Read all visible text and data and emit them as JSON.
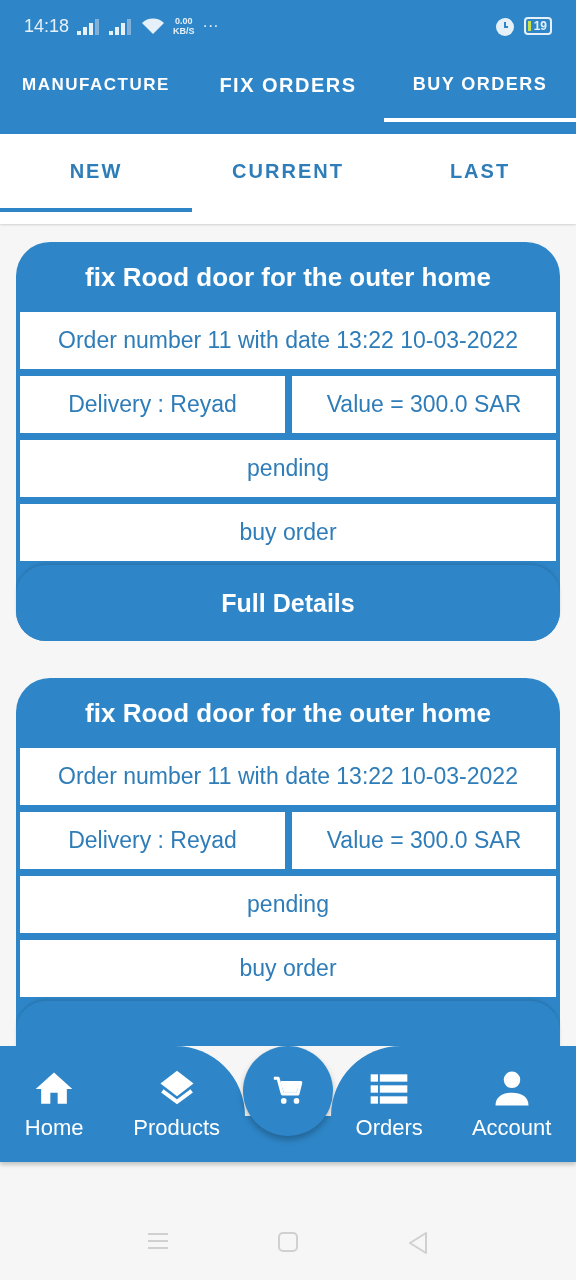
{
  "status_bar": {
    "time": "14:18",
    "net_speed": "0.00",
    "net_unit": "KB/S",
    "more": "···",
    "battery": "19"
  },
  "top_tabs": [
    {
      "label": "MANUFACTURE",
      "selected": false
    },
    {
      "label": "FIX ORDERS",
      "selected": false
    },
    {
      "label": "BUY ORDERS",
      "selected": true
    }
  ],
  "sub_tabs": [
    {
      "label": "NEW",
      "selected": true
    },
    {
      "label": "CURRENT",
      "selected": false
    },
    {
      "label": "LAST",
      "selected": false
    }
  ],
  "orders": [
    {
      "title": "fix Rood door for the outer home",
      "order_line": "Order number 11 with date 13:22 10-03-2022",
      "delivery": "Delivery : Reyad",
      "value": "Value = 300.0 SAR",
      "status": "pending",
      "type": "buy order",
      "button": "Full Details"
    },
    {
      "title": "fix Rood door for the outer home",
      "order_line": "Order number 11 with date 13:22 10-03-2022",
      "delivery": "Delivery : Reyad",
      "value": "Value = 300.0 SAR",
      "status": "pending",
      "type": "buy order"
    }
  ],
  "bottom_nav": [
    {
      "kind": "home",
      "label": "Home"
    },
    {
      "kind": "layers",
      "label": "Products"
    },
    {
      "kind": "cart"
    },
    {
      "kind": "list",
      "label": "Orders"
    },
    {
      "kind": "person",
      "label": "Account"
    }
  ]
}
